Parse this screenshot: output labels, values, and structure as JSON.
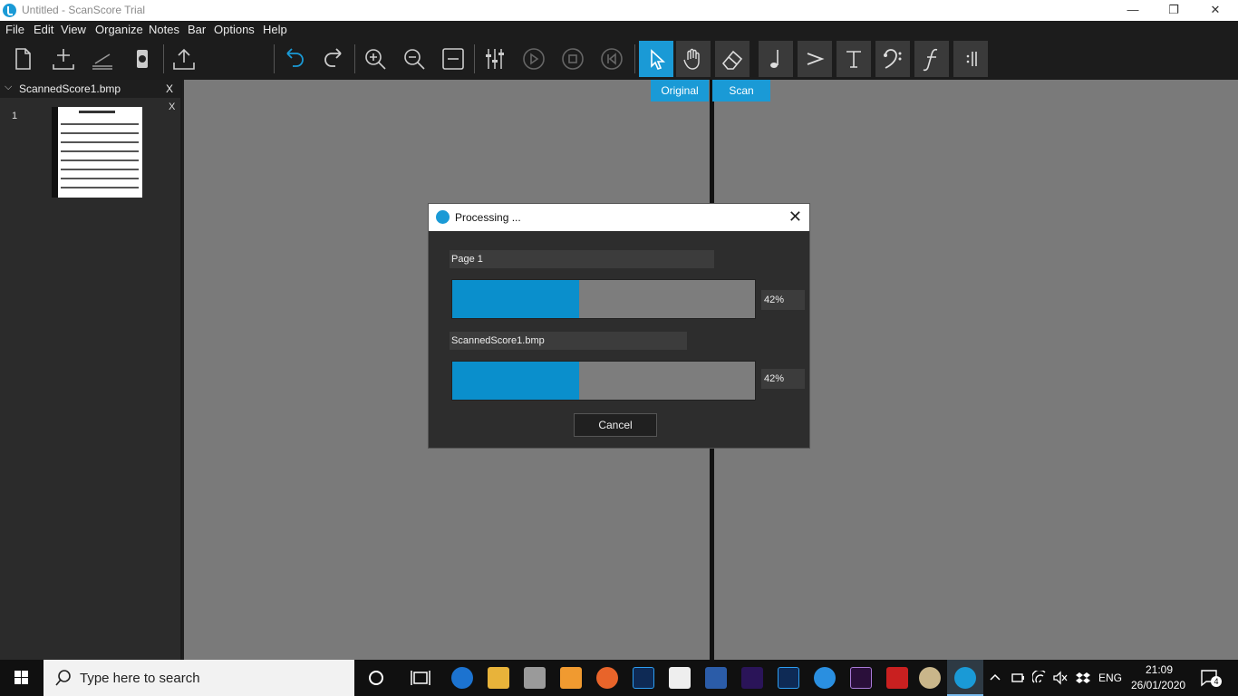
{
  "window": {
    "title": "Untitled - ScanScore Trial",
    "minimize": "—",
    "restore": "❐",
    "close": "✕"
  },
  "menu": [
    "File",
    "Edit",
    "View",
    "Organize",
    "Notes",
    "Bar",
    "Options",
    "Help"
  ],
  "toolbar": {
    "icons": [
      "new-document-icon",
      "add-icon",
      "scan-icon",
      "help-icon",
      "export-icon",
      "undo-icon",
      "redo-icon",
      "zoom-in-icon",
      "zoom-out-icon",
      "fit-width-icon",
      "mixer-icon",
      "play-icon",
      "stop-icon",
      "rewind-icon",
      "select-icon",
      "hand-icon",
      "eraser-icon",
      "note-icon",
      "accent-icon",
      "text-icon",
      "clef-icon",
      "dynamics-icon",
      "barline-icon"
    ],
    "active_tool": "select-icon"
  },
  "view_tabs": {
    "original": "Original",
    "scan": "Scan"
  },
  "file_panel": {
    "file_name": "ScannedScore1.bmp",
    "close": "X",
    "chevron": "⌵",
    "page_number": "1",
    "page_close": "X"
  },
  "dialog": {
    "title": "Processing ...",
    "close": "✕",
    "page_label": "Page 1",
    "page_progress": 0.42,
    "page_percent": "42%",
    "file_label": "ScannedScore1.bmp",
    "file_progress": 0.42,
    "file_percent": "42%",
    "cancel": "Cancel"
  },
  "taskbar": {
    "search_placeholder": "Type here to search",
    "language": "ENG",
    "time": "21:09",
    "date": "26/01/2020",
    "notifications": "4",
    "app_icons": [
      "cortana-icon",
      "task-view-icon",
      "edge-icon",
      "file-explorer-icon",
      "printer-app-icon",
      "media-player-icon",
      "firefox-icon",
      "photoshop-icon",
      "inkscape-icon",
      "word-icon",
      "amazon-music-icon",
      "photoshop-icon-2",
      "internet-explorer-icon",
      "premiere-icon",
      "filezilla-icon",
      "paint-icon",
      "scanscore-icon"
    ]
  },
  "colors": {
    "accent": "#1a9ad6",
    "canvas": "#7a7a7a",
    "panel": "#2b2b2b",
    "dialog": "#2d2d2d"
  }
}
